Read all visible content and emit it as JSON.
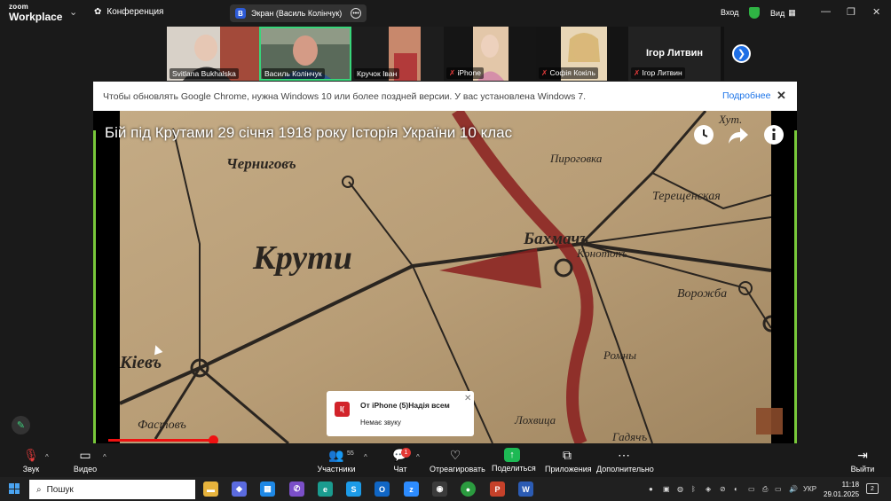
{
  "app": {
    "logo_small": "zoom",
    "logo_big": "Workplace",
    "conference_label": "Конференция"
  },
  "screen_pill": {
    "avatar_letter": "В",
    "label": "Экран (Василь Колінчук)"
  },
  "titlebar": {
    "login": "Вход",
    "view": "Вид"
  },
  "participants": [
    {
      "name": "Svitlana Bukhalska",
      "muted": false,
      "photo": true
    },
    {
      "name": "Василь Колінчук",
      "muted": false,
      "photo": true,
      "active": true
    },
    {
      "name": "Кручок Іван",
      "muted": false,
      "photo": true
    },
    {
      "name": "iPhone",
      "muted": true,
      "photo": false
    },
    {
      "name": "Софія Кокіль",
      "muted": true,
      "photo": true
    },
    {
      "name": "Ігор Литвин",
      "muted": true,
      "photo": false,
      "big_name": "Ігор Литвин"
    }
  ],
  "banner": {
    "text": "Чтобы обновлять Google Chrome, нужна Windows 10 или более поздней версии. У вас установлена Windows 7.",
    "more": "Подробнее"
  },
  "video": {
    "title": "Бій під Крутами 29 січня 1918 року Історія України 10 клас",
    "map_labels": [
      "Черниговъ",
      "Крути",
      "Бахмачъ",
      "Конотопъ",
      "Терещенская",
      "Пироговка",
      "Ворожба",
      "Кiевъ",
      "Ромны",
      "Фастовъ",
      "Лохвица",
      "Гадячъ",
      "Хут."
    ]
  },
  "chat_popup": {
    "avatar": "I(",
    "title": "От iPhone (5)Надія всем",
    "message": "Немає звуку"
  },
  "toolbar": {
    "audio": "Звук",
    "video": "Видео",
    "participants": "Участники",
    "participants_count": "55",
    "chat": "Чат",
    "chat_badge": "1",
    "react": "Отреагировать",
    "share": "Поделиться",
    "apps": "Приложения",
    "more": "Дополнительно",
    "leave": "Выйти"
  },
  "taskbar": {
    "search": "Пошук",
    "lang": "УКР",
    "time": "11:18",
    "date": "29.01.2025",
    "notif_count": "2"
  },
  "colors": {
    "accent": "#1f6fe5",
    "active_tile": "#37d67a",
    "share_green": "#1db954",
    "mute_red": "#e23a3a"
  }
}
